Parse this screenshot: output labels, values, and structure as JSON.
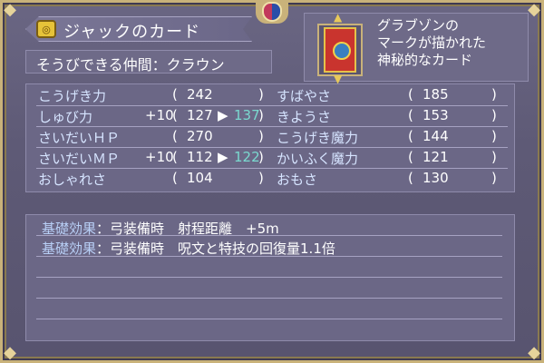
{
  "header": {
    "title": "ジャックのカード",
    "title_icon": "item-card-icon"
  },
  "party": {
    "label": "そうびできる仲間：クラウン"
  },
  "description": {
    "lines": [
      "グラブゾンの",
      "マークが描かれた",
      "神秘的なカード"
    ]
  },
  "stats": [
    {
      "left_label": "こうげき力",
      "left_bonus": "",
      "left_value": "242",
      "left_new": "",
      "right_label": "すばやさ",
      "right_value": "185"
    },
    {
      "left_label": "しゅび力",
      "left_bonus": "+10",
      "left_value": "127",
      "left_new": "137",
      "right_label": "きようさ",
      "right_value": "153"
    },
    {
      "left_label": "さいだいＨＰ",
      "left_bonus": "",
      "left_value": "270",
      "left_new": "",
      "right_label": "こうげき魔力",
      "right_value": "144"
    },
    {
      "left_label": "さいだいＭＰ",
      "left_bonus": "+10",
      "left_value": "112",
      "left_new": "122",
      "right_label": "かいふく魔力",
      "right_value": "121"
    },
    {
      "left_label": "おしゃれさ",
      "left_bonus": "",
      "left_value": "104",
      "left_new": "",
      "right_label": "おもさ",
      "right_value": "130"
    }
  ],
  "effects": [
    {
      "key": "基礎効果",
      "text": "：弓装備時　射程距離　+5m"
    },
    {
      "key": "基礎効果",
      "text": "：弓装備時　呪文と特技の回復量1.1倍"
    }
  ],
  "colors": {
    "frame_gold": "#c9b27a",
    "panel": "#6b6786",
    "label_blue": "#d6e4ff",
    "increase": "#7ad9cf"
  }
}
